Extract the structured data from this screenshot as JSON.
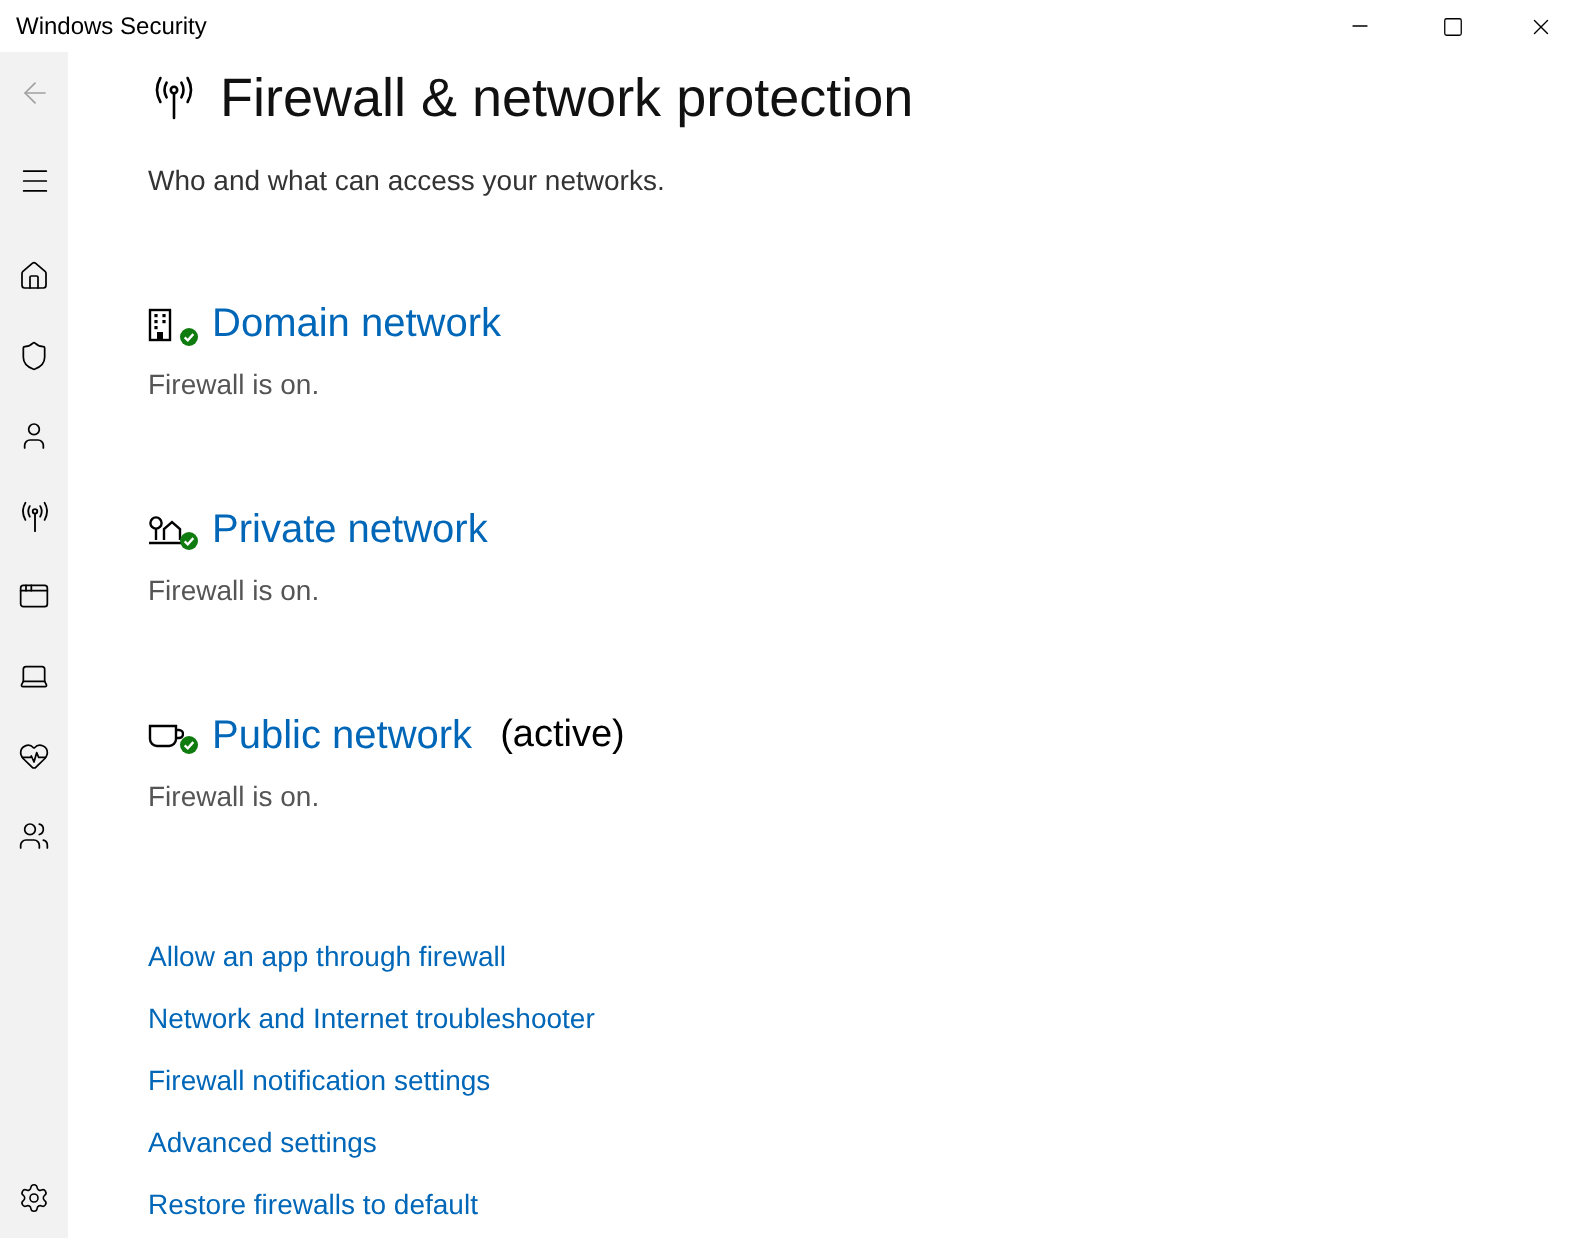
{
  "window": {
    "title": "Windows Security"
  },
  "page": {
    "title": "Firewall & network protection",
    "subtitle": "Who and what can access your networks."
  },
  "networks": [
    {
      "kind": "domain",
      "name": "Domain network",
      "status": "Firewall is on.",
      "protected": true
    },
    {
      "kind": "private",
      "name": "Private network",
      "status": "Firewall is on.",
      "protected": true
    },
    {
      "kind": "public",
      "name": "Public network",
      "tag": "(active)",
      "status": "Firewall is on.",
      "protected": true
    }
  ],
  "links": [
    "Allow an app through firewall",
    "Network and Internet troubleshooter",
    "Firewall notification settings",
    "Advanced settings",
    "Restore firewalls to default"
  ]
}
